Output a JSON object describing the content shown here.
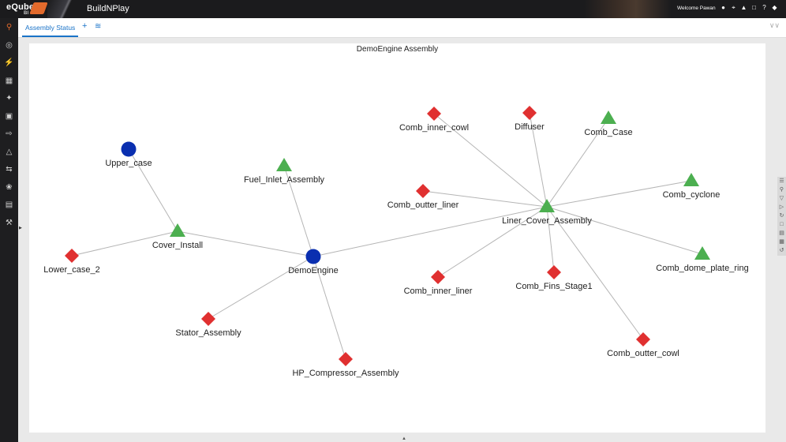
{
  "header": {
    "logo_text": "eQube",
    "logo_sub": "BI",
    "app_name": "BuildNPlay",
    "welcome": "Welcome Pawan",
    "icons": [
      "user-icon",
      "crosshair-icon",
      "bell-icon",
      "share-icon",
      "help-icon",
      "settings-icon"
    ]
  },
  "sidebar": {
    "icons": [
      "search-icon",
      "compass-icon",
      "plug-icon",
      "formula-icon",
      "sparkle-icon",
      "calendar-icon",
      "export-icon",
      "shapes-icon",
      "transfer-icon",
      "brain-icon",
      "book-icon",
      "tools-icon"
    ]
  },
  "tabs": {
    "active_label": "Assembly Status",
    "add_label": "+"
  },
  "diagram": {
    "title": "DemoEngine Assembly",
    "nodes": [
      {
        "id": "upper_case",
        "label": "Upper_case",
        "shape": "circle",
        "color": "#0a2fb0"
      },
      {
        "id": "cover_install",
        "label": "Cover_Install",
        "shape": "triangle",
        "color": "#4caf50"
      },
      {
        "id": "lower_case_2",
        "label": "Lower_case_2",
        "shape": "diamond",
        "color": "#e03030"
      },
      {
        "id": "fuel_inlet",
        "label": "Fuel_Inlet_Assembly",
        "shape": "triangle",
        "color": "#4caf50"
      },
      {
        "id": "demoengine",
        "label": "DemoEngine",
        "shape": "circle",
        "color": "#0a2fb0"
      },
      {
        "id": "stator",
        "label": "Stator_Assembly",
        "shape": "diamond",
        "color": "#e03030"
      },
      {
        "id": "hp_comp",
        "label": "HP_Compressor_Assembly",
        "shape": "diamond",
        "color": "#e03030"
      },
      {
        "id": "liner_cover",
        "label": "Liner_Cover_Assembly",
        "shape": "triangle",
        "color": "#4caf50"
      },
      {
        "id": "comb_inner_cowl",
        "label": "Comb_inner_cowl",
        "shape": "diamond",
        "color": "#e03030"
      },
      {
        "id": "diffuser",
        "label": "Diffuser",
        "shape": "diamond",
        "color": "#e03030"
      },
      {
        "id": "comb_case",
        "label": "Comb_Case",
        "shape": "triangle",
        "color": "#4caf50"
      },
      {
        "id": "comb_cyclone",
        "label": "Comb_cyclone",
        "shape": "triangle",
        "color": "#4caf50"
      },
      {
        "id": "comb_dome",
        "label": "Comb_dome_plate_ring",
        "shape": "triangle",
        "color": "#4caf50"
      },
      {
        "id": "comb_outter_liner",
        "label": "Comb_outter_liner",
        "shape": "diamond",
        "color": "#e03030"
      },
      {
        "id": "comb_inner_liner",
        "label": "Comb_inner_liner",
        "shape": "diamond",
        "color": "#e03030"
      },
      {
        "id": "comb_fins",
        "label": "Comb_Fins_Stage1",
        "shape": "diamond",
        "color": "#e03030"
      },
      {
        "id": "comb_outter_cowl",
        "label": "Comb_outter_cowl",
        "shape": "diamond",
        "color": "#e03030"
      }
    ],
    "edges": [
      [
        "upper_case",
        "cover_install"
      ],
      [
        "cover_install",
        "lower_case_2"
      ],
      [
        "cover_install",
        "demoengine"
      ],
      [
        "fuel_inlet",
        "demoengine"
      ],
      [
        "demoengine",
        "stator"
      ],
      [
        "demoengine",
        "hp_comp"
      ],
      [
        "demoengine",
        "liner_cover"
      ],
      [
        "liner_cover",
        "comb_inner_cowl"
      ],
      [
        "liner_cover",
        "diffuser"
      ],
      [
        "liner_cover",
        "comb_case"
      ],
      [
        "liner_cover",
        "comb_cyclone"
      ],
      [
        "liner_cover",
        "comb_dome"
      ],
      [
        "liner_cover",
        "comb_outter_liner"
      ],
      [
        "liner_cover",
        "comb_inner_liner"
      ],
      [
        "liner_cover",
        "comb_fins"
      ],
      [
        "liner_cover",
        "comb_outter_cowl"
      ]
    ],
    "edge_color": "#b5b5b5"
  },
  "toolbar_right": {
    "icons": [
      "menu-icon",
      "pin-icon",
      "filter-icon",
      "play-icon",
      "refresh-icon",
      "copy-icon",
      "print-icon",
      "table-icon",
      "reload-icon"
    ]
  }
}
